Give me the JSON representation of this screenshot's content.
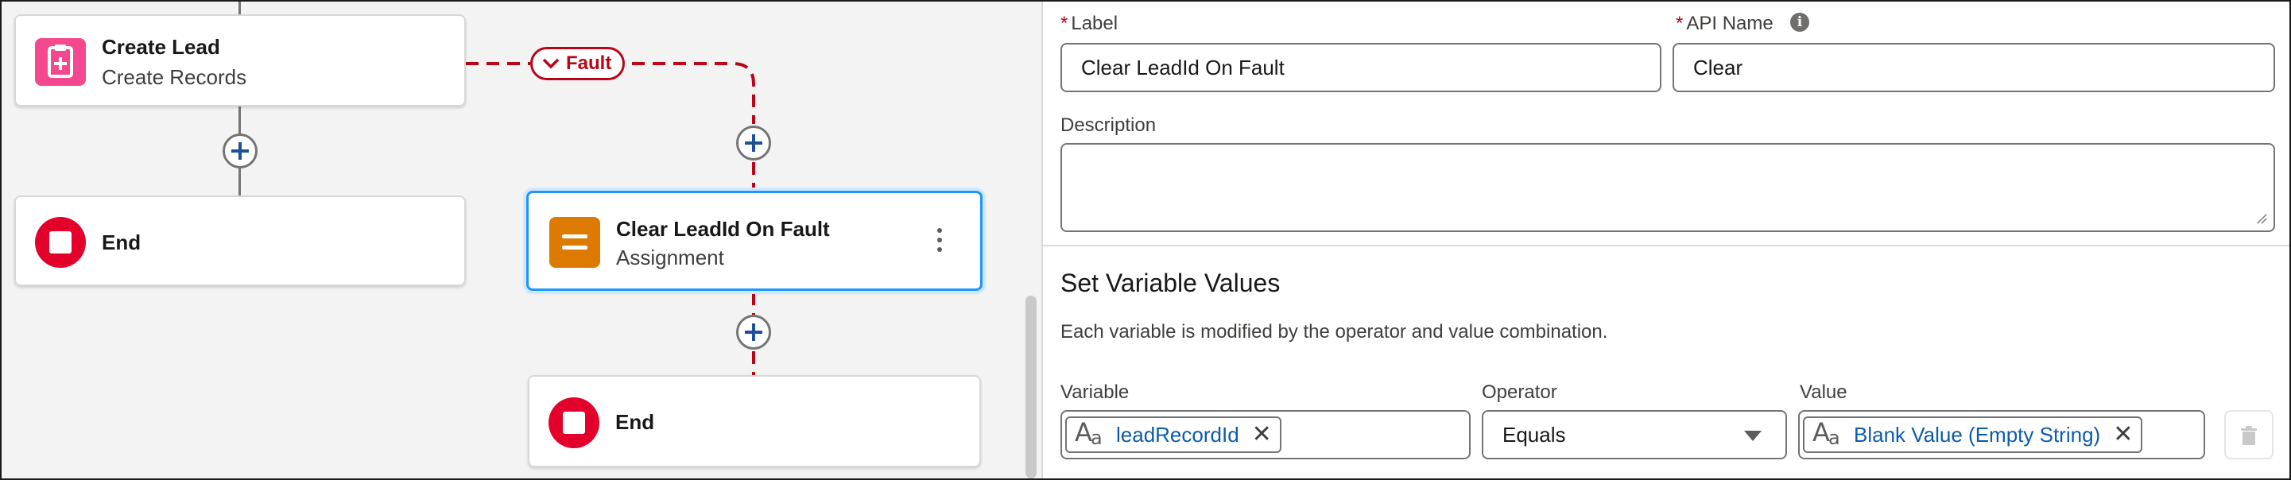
{
  "canvas": {
    "create_lead": {
      "title": "Create Lead",
      "subtitle": "Create Records"
    },
    "end_left": {
      "title": "End"
    },
    "fault_label": "Fault",
    "clear_node": {
      "title": "Clear LeadId On Fault",
      "subtitle": "Assignment"
    },
    "end_right": {
      "title": "End"
    }
  },
  "panel": {
    "label_field": {
      "label": "Label",
      "value": "Clear LeadId On Fault"
    },
    "api_name_field": {
      "label": "API Name",
      "value": "Clear"
    },
    "description_field": {
      "label": "Description",
      "value": ""
    },
    "section": {
      "title": "Set Variable Values",
      "description": "Each variable is modified by the operator and value combination."
    },
    "columns": {
      "variable": "Variable",
      "operator": "Operator",
      "value": "Value"
    },
    "row": {
      "variable": "leadRecordId",
      "operator": "Equals",
      "value": "Blank Value (Empty String)"
    }
  },
  "colors": {
    "accent": "#1b96ff",
    "fault": "#ba0517",
    "end": "#e3002b",
    "assignment": "#dd7a01",
    "create": "#f4488f",
    "link": "#0b5cab"
  },
  "icons": [
    "create-record-icon",
    "stop-icon",
    "assignment-icon",
    "plus-icon",
    "chevron-down-icon",
    "info-icon",
    "text-variable-icon",
    "close-icon",
    "trash-icon",
    "more-actions-icon"
  ]
}
